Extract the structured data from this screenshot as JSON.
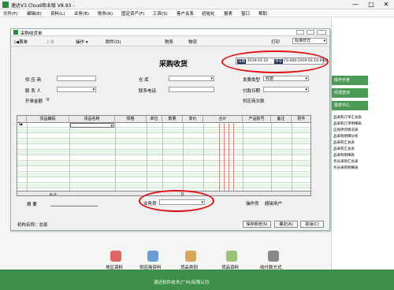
{
  "app": {
    "title": "速达V3.Cloud商业版 V8.93 - ",
    "window_controls": [
      "—",
      "□",
      "✕"
    ]
  },
  "menus": [
    "文件(F)",
    "编辑(E)",
    "资料(L)",
    "业务(B)",
    "账务(R)",
    "固定资产(F)",
    "工资(S)",
    "客户关系",
    "初始化",
    "报表",
    "窗口",
    "帮助"
  ],
  "right_panel": {
    "buttons": [
      "操作手册",
      "经理查询",
      "报表中心"
    ],
    "links": [
      "品采购订单汇总表",
      "品采购订单明细表",
      "应商供货情况表",
      "品采购明细分析",
      "品采购汇总表",
      "品采购汇总表",
      "品采购明细表",
      "务员采购汇总表",
      "务员采购明细表"
    ]
  },
  "dialog": {
    "title": "采购收货单",
    "toolbar": {
      "first": "|◀首单",
      "prev": "上单",
      "operation": "操作 ▾",
      "attachment": "附件(O)",
      "tax": "税务",
      "logistics": "物流",
      "print": "打印",
      "print_style": "标准样式"
    },
    "heading": "采购收货",
    "date_label": "日期",
    "date_value": "2019-01-10",
    "doc_no_label": "单号",
    "doc_no_value": "CS-000-2019-01-10-0001",
    "fields": {
      "supplier_label": "供 应 商",
      "warehouse_label": "仓    库",
      "invoice_type_label": "发票类型",
      "invoice_type_value": "收据",
      "contact_label": "联 系 人",
      "contact_phone_label": "联系电话",
      "pay_date_label": "付款日期",
      "open_amount_label": "开单金额",
      "open_amount_value": "0",
      "payable_label": "供应商欠款"
    },
    "grid": {
      "columns": [
        "货品编码",
        "货品名称",
        "规格",
        "单位",
        "数量",
        "单价",
        "合计",
        "产品批号",
        "备注",
        "附件"
      ],
      "first_row_marker": "1▶",
      "total_label": "合计",
      "total_value": "0"
    },
    "summary_label": "摘    要",
    "salesperson_label": "业务员",
    "operator_label": "操作员",
    "operator_value": "超级用户",
    "org_label": "机构名称：总部",
    "buttons": {
      "save_new": "保存新增(S)",
      "confirm": "确定(A)",
      "cancel": "取消(C)"
    }
  },
  "bottom_modules": [
    "地区资料",
    "供应商资料",
    "货品类别",
    "货品资料",
    "收付款方式"
  ],
  "footer": "速达软件技术(广州)有限公司",
  "colors": {
    "accent_green": "#3f8f4a",
    "highlight_red": "#e01010"
  }
}
